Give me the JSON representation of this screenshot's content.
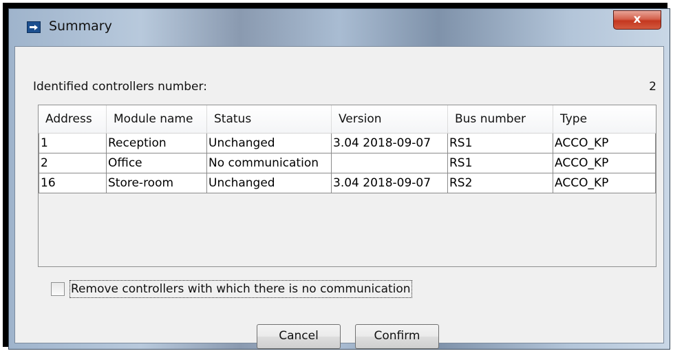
{
  "window": {
    "title": "Summary",
    "close_label": "x"
  },
  "summary": {
    "count_label": "Identified controllers number:",
    "count_value": "2"
  },
  "table": {
    "columns": [
      "Address",
      "Module name",
      "Status",
      "Version",
      "Bus number",
      "Type"
    ],
    "rows": [
      [
        "1",
        "Reception",
        "Unchanged",
        "3.04 2018-09-07",
        "RS1",
        "ACCO_KP"
      ],
      [
        "2",
        "Office",
        "No communication",
        "",
        "RS1",
        "ACCO_KP"
      ],
      [
        "16",
        "Store-room",
        "Unchanged",
        "3.04 2018-09-07",
        "RS2",
        "ACCO_KP"
      ]
    ]
  },
  "options": {
    "remove_label": "Remove controllers with which there is no communication",
    "remove_checked": false
  },
  "buttons": {
    "cancel": "Cancel",
    "confirm": "Confirm"
  }
}
